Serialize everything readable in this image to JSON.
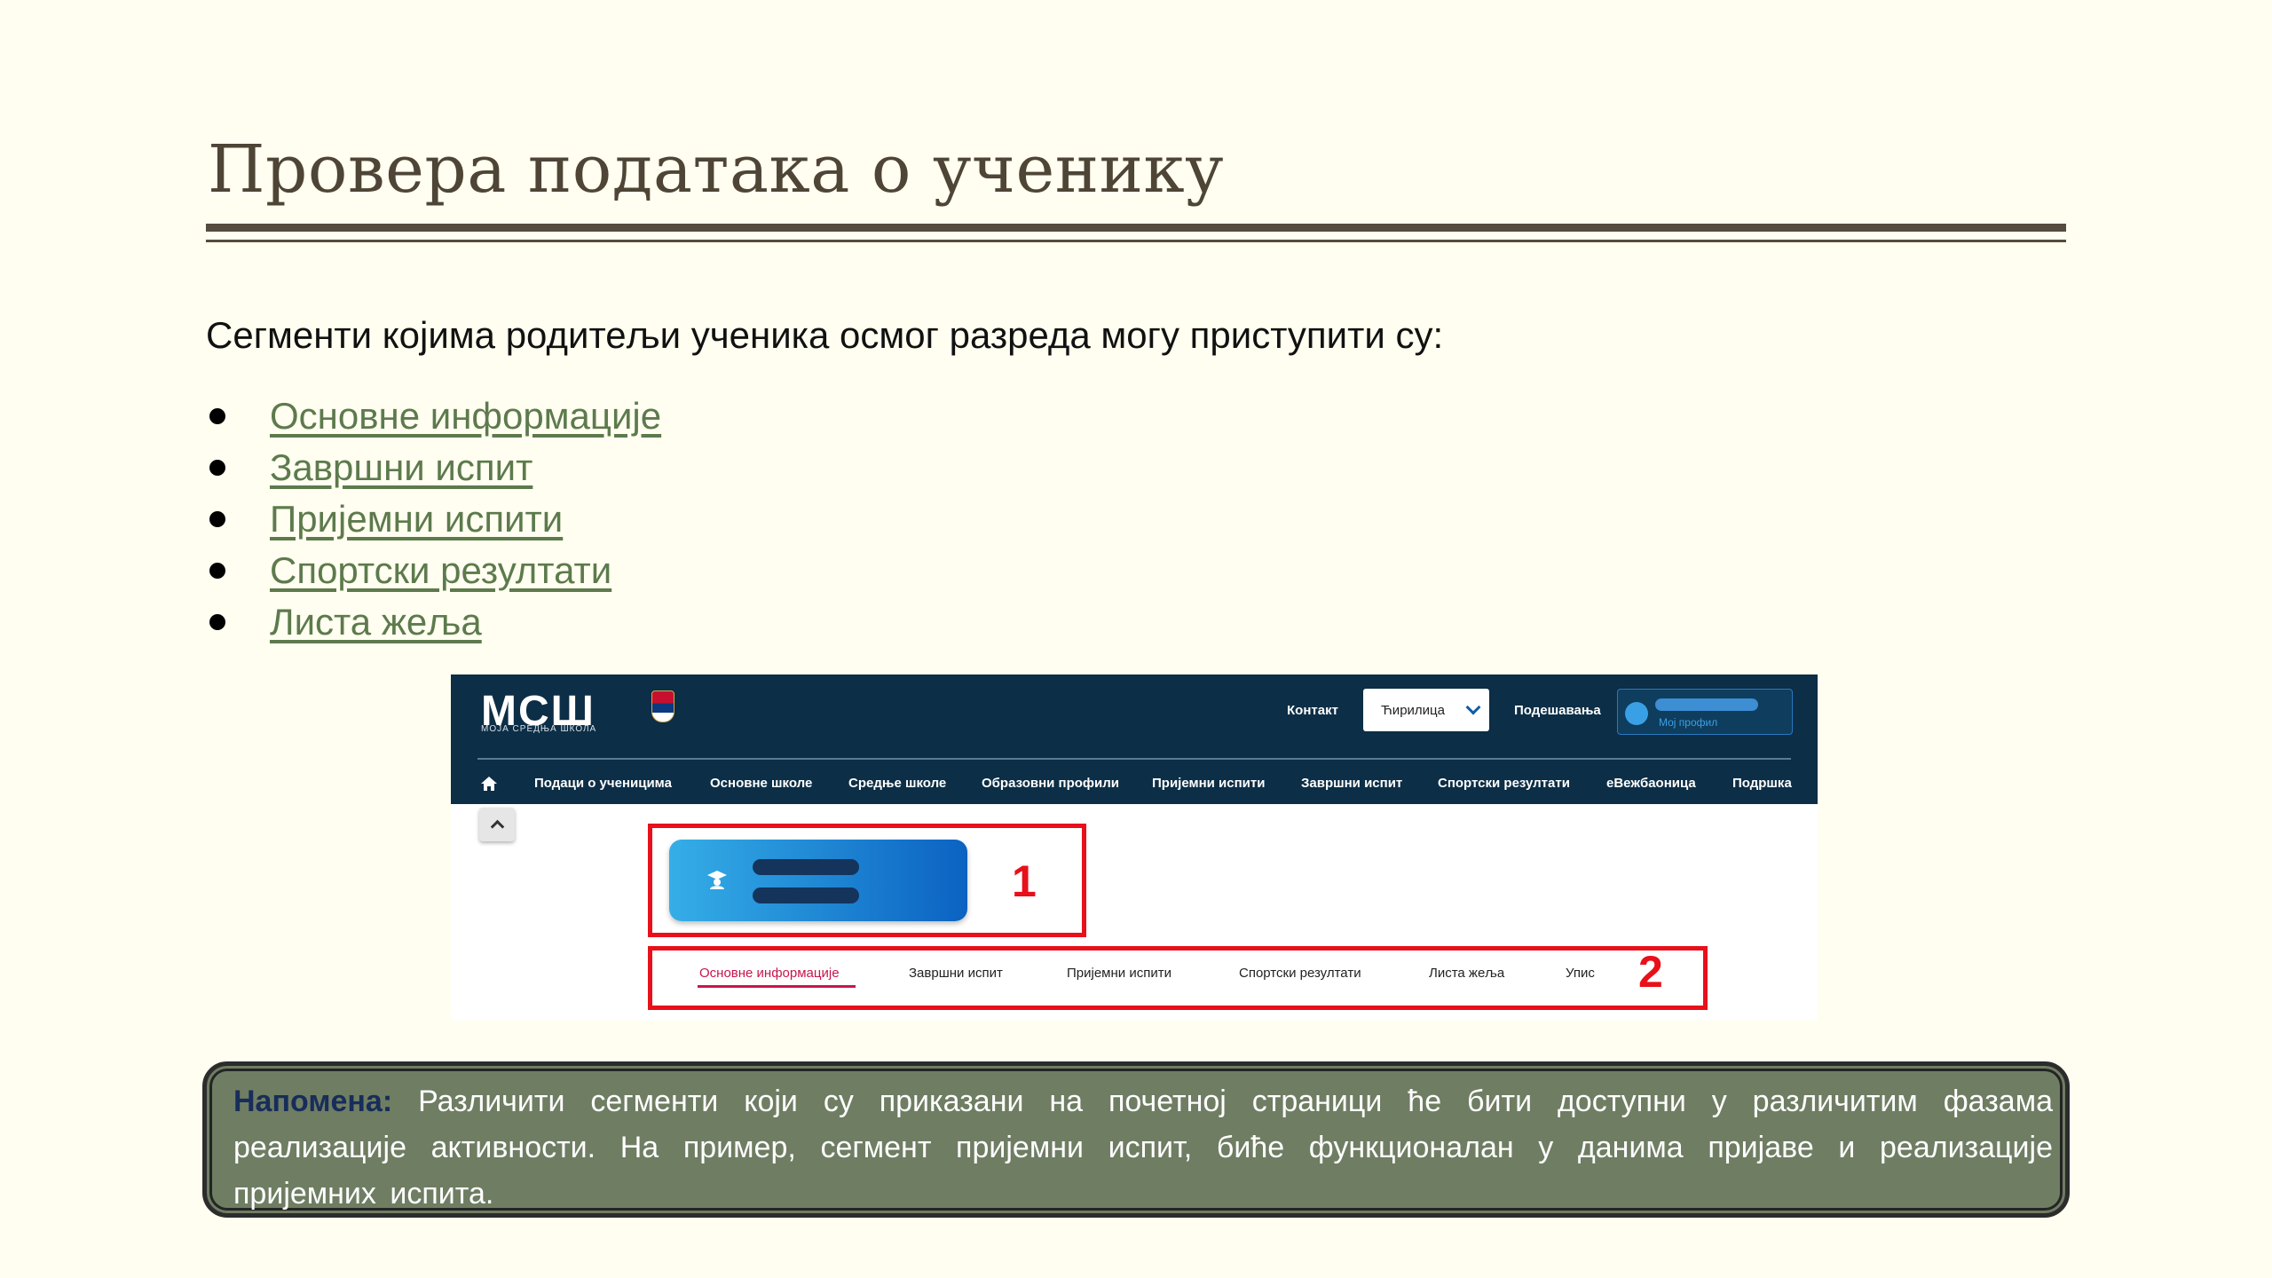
{
  "title": "Провера података о ученику",
  "intro": "Сегменти којима родитељи ученика осмог разреда могу приступити су:",
  "segments": [
    "Основне информације",
    "Завршни испит",
    "Пријемни испити",
    "Спортски резултати",
    "Листа жеља"
  ],
  "screenshot": {
    "logo": "МСШ",
    "logo_subtitle": "МОЈА СРЕДЊА ШКОЛА",
    "header_links": {
      "contact": "Контакт",
      "language": "Ћирилица",
      "settings": "Подешавања",
      "profile": "Мој профил"
    },
    "nav": [
      "Подаци о ученицима",
      "Основне школе",
      "Средње школе",
      "Образовни профили",
      "Пријемни испити",
      "Завршни испит",
      "Спортски резултати",
      "еВежбаоница",
      "Подршка"
    ],
    "tabs": [
      "Основне информације",
      "Завршни испит",
      "Пријемни испити",
      "Спортски резултати",
      "Листа жеља",
      "Упис"
    ],
    "markers": [
      "1",
      "2"
    ]
  },
  "note": {
    "label": "Напомена:",
    "text": " Различити сегменти који су приказани на почетној страници ће бити доступни у различитим фазама реализације активности. На пример, сегмент пријемни испит, биће функционалан у данима пријаве и реализације пријемних испита."
  }
}
